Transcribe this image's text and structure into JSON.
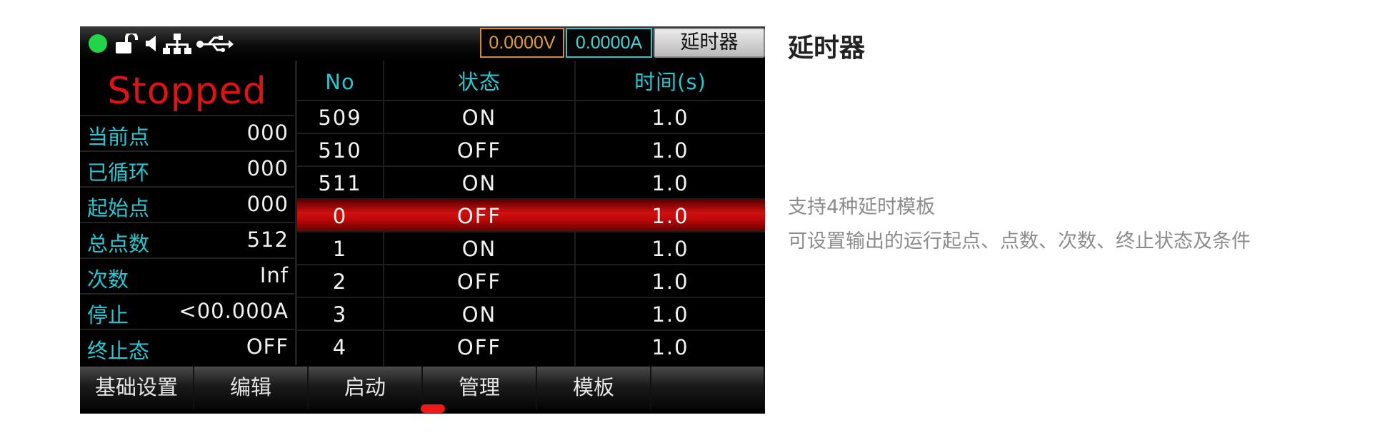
{
  "topbar": {
    "voltage": "0.0000V",
    "current": "0.0000A",
    "mode_tab": "延时器",
    "icons": [
      "status-dot",
      "unlock-icon",
      "speaker-icon",
      "network-icon",
      "usb-icon"
    ],
    "colors": {
      "status_dot": "#22d44a",
      "voltage": "#e39b3a",
      "current": "#47d0d3"
    }
  },
  "panel": {
    "state": "Stopped",
    "rows": [
      {
        "label": "当前点",
        "value": "000"
      },
      {
        "label": "已循环",
        "value": "000"
      },
      {
        "label": "起始点",
        "value": "000"
      },
      {
        "label": "总点数",
        "value": "512"
      },
      {
        "label": "次数",
        "value": "Inf"
      },
      {
        "label": "停止",
        "value": "<00.000A"
      },
      {
        "label": "终止态",
        "value": "OFF"
      }
    ]
  },
  "table": {
    "headers": [
      "No",
      "状态",
      "时间(s)"
    ],
    "rows": [
      {
        "no": "509",
        "state": "ON",
        "time": "1.0"
      },
      {
        "no": "510",
        "state": "OFF",
        "time": "1.0"
      },
      {
        "no": "511",
        "state": "ON",
        "time": "1.0"
      },
      {
        "no": "0",
        "state": "OFF",
        "time": "1.0"
      },
      {
        "no": "1",
        "state": "ON",
        "time": "1.0"
      },
      {
        "no": "2",
        "state": "OFF",
        "time": "1.0"
      },
      {
        "no": "3",
        "state": "ON",
        "time": "1.0"
      },
      {
        "no": "4",
        "state": "OFF",
        "time": "1.0"
      }
    ],
    "selected_no": "0"
  },
  "softkeys": [
    "基础设置",
    "编辑",
    "启动",
    "管理",
    "模板",
    ""
  ],
  "description": {
    "title": "延时器",
    "lines": [
      "支持4种延时模板",
      "可设置输出的运行起点、点数、次数、终止状态及条件"
    ]
  }
}
